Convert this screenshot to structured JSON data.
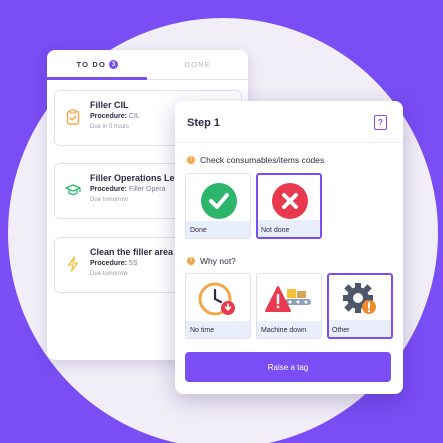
{
  "tabs": {
    "todo_label": "TO DO",
    "todo_count": "3",
    "done_label": "DONE"
  },
  "tasks": [
    {
      "title": "Filler CIL",
      "procedure_label": "Procedure:",
      "procedure_value": "CIL",
      "due": "Due in 5 hours",
      "icon": "clipboard-icon",
      "icon_color": "#f4a64a"
    },
    {
      "title": "Filler Operations Le",
      "procedure_label": "Procedure:",
      "procedure_value": "Filler Opera",
      "due": "Due tomorrow",
      "icon": "graduation-cap-icon",
      "icon_color": "#2dbb73"
    },
    {
      "title": "Clean the filler area",
      "procedure_label": "Procedure:",
      "procedure_value": "5S",
      "due": "Due tomorrow",
      "icon": "lightning-icon",
      "icon_color": "#f4c23a"
    }
  ],
  "step": {
    "title": "Step 1",
    "help_icon": "book-help-icon",
    "question1": "Check consumables/items codes",
    "options1": [
      {
        "label": "Done",
        "icon": "check-circle-icon",
        "color": "#2db56c"
      },
      {
        "label": "Not done",
        "icon": "x-circle-icon",
        "color": "#e8394e"
      }
    ],
    "question2": "Why not?",
    "options2": [
      {
        "label": "No time",
        "icon": "clock-alert-icon"
      },
      {
        "label": "Machine down",
        "icon": "warning-machine-icon"
      },
      {
        "label": "Other",
        "icon": "gear-alert-icon"
      }
    ],
    "button": "Raise a tag"
  },
  "colors": {
    "accent": "#7a4df5",
    "background": "#f1eef8",
    "warning": "#f4a64a"
  }
}
